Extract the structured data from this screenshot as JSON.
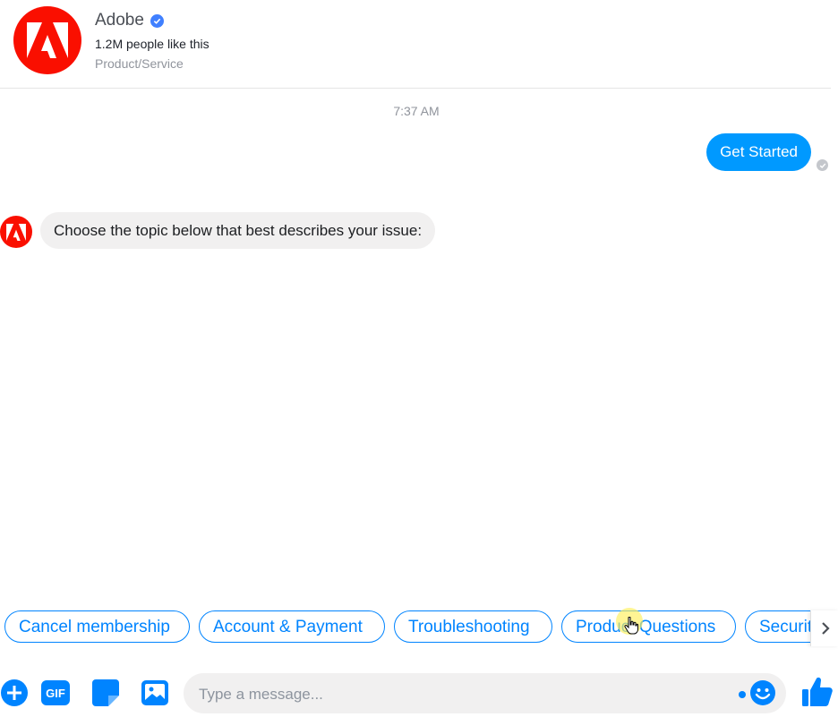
{
  "header": {
    "page_name": "Adobe",
    "likes": "1.2M people like this",
    "category": "Product/Service"
  },
  "conversation": {
    "timestamp": "7:37 AM",
    "outgoing_message": "Get Started",
    "incoming_message": "Choose the topic below that best describes your issue:"
  },
  "quick_replies": [
    {
      "label": "Cancel membership"
    },
    {
      "label": "Account & Payment"
    },
    {
      "label": "Troubleshooting"
    },
    {
      "label": "Product Questions"
    },
    {
      "label": "Security"
    }
  ],
  "composer": {
    "placeholder": "Type a message...",
    "gif_label": "GIF"
  },
  "colors": {
    "messenger_blue": "#0084ff",
    "outgoing_bubble": "#0099ff",
    "adobe_red": "#fa0f00"
  },
  "icons": [
    "adobe-logo-icon",
    "verified-badge-icon",
    "seen-check-icon",
    "chevron-right-icon",
    "plus-icon",
    "gif-icon",
    "sticker-icon",
    "photo-icon",
    "emoji-icon",
    "thumbs-up-icon"
  ]
}
